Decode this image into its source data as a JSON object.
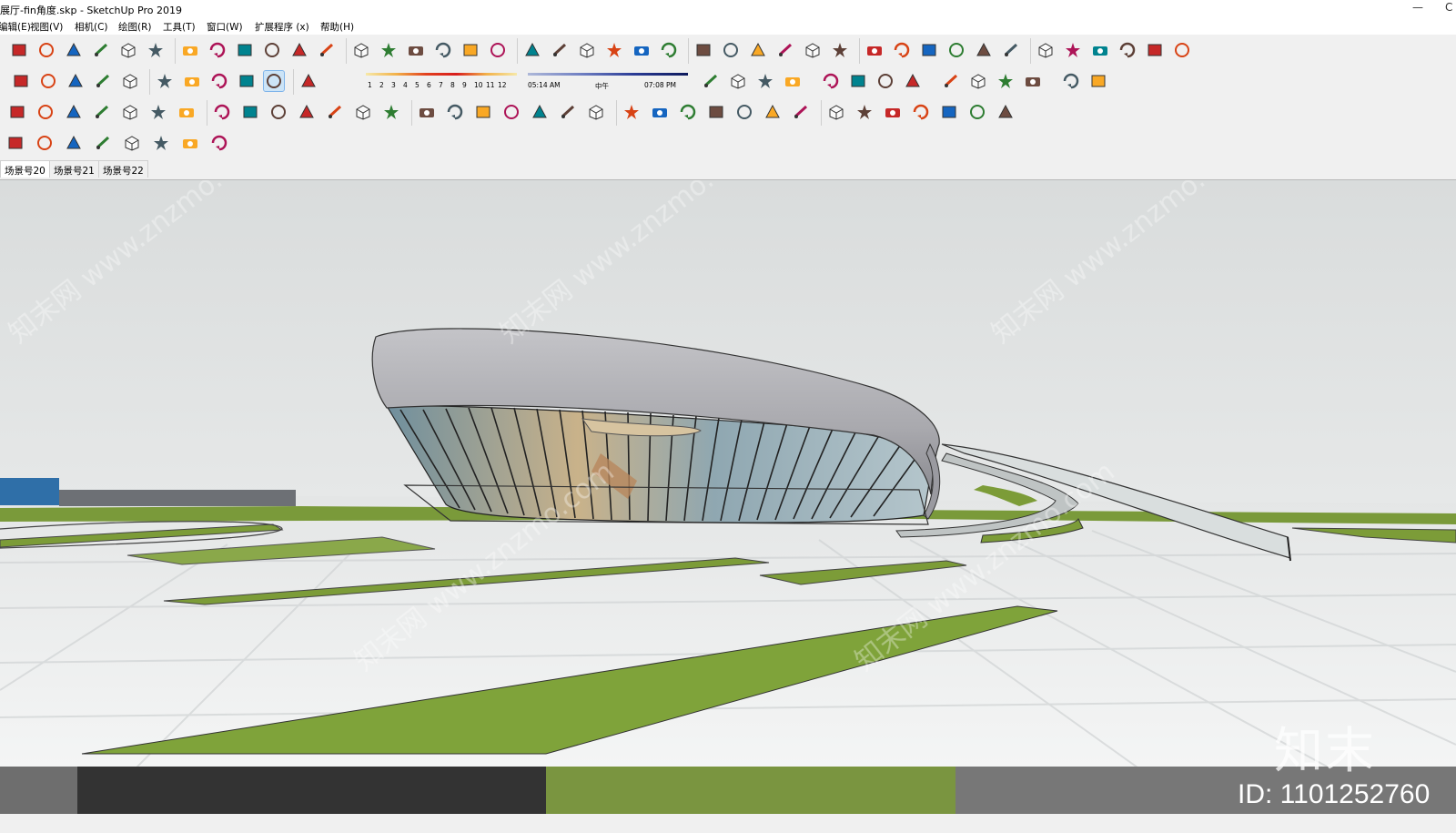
{
  "window": {
    "title": "展厅-fin角度.skp - SketchUp Pro 2019",
    "minimize_glyph": "—",
    "right_glyph": "C"
  },
  "menu": [
    {
      "label": "编辑(E)"
    },
    {
      "label": "视图(V)"
    },
    {
      "label": "相机(C)"
    },
    {
      "label": "绘图(R)"
    },
    {
      "label": "工具(T)"
    },
    {
      "label": "窗口(W)"
    },
    {
      "label": "扩展程序 (x)"
    },
    {
      "label": "帮助(H)"
    }
  ],
  "shadow_settings": {
    "months": [
      "1",
      "2",
      "3",
      "4",
      "5",
      "6",
      "7",
      "8",
      "9",
      "10",
      "11",
      "12"
    ],
    "sunrise_time": "05:14 AM",
    "noon_label": "中午",
    "sunset_time": "07:08 PM"
  },
  "scenes": [
    {
      "label": "场景号20",
      "selected": true
    },
    {
      "label": "场景号21",
      "selected": false
    },
    {
      "label": "场景号22",
      "selected": false
    }
  ],
  "watermark": {
    "id_text": "ID: 1101252760",
    "logo_text": "知末"
  },
  "icons": {
    "row1": [
      "pencil-icon",
      "arc-icon",
      "rectangle-icon",
      "push-pull-icon",
      "follow-me-icon",
      "move-icon",
      "rotate-icon",
      "scale-icon",
      "tape-measure-icon",
      "text-icon",
      "paint-bucket-icon",
      "orbit-icon",
      "pan-icon",
      "zoom-icon",
      "zoom-extents-icon",
      "outer-shell-icon",
      "intersect-icon",
      "subtract-icon",
      "ruby-icon",
      "user-icon",
      "section-icon",
      "cone-icon",
      "circle-icon",
      "protractor-icon",
      "axes-icon",
      "sun-icon",
      "dome-icon",
      "sphere-icon",
      "x-ray-icon",
      "components-icon",
      "iso-view-icon",
      "top-view-icon",
      "front-view-icon",
      "right-view-icon",
      "back-view-icon",
      "left-view-icon",
      "check-icon",
      "teapot-icon",
      "cloud-icon",
      "sync-icon",
      "layers-icon",
      "window-icon"
    ],
    "row2": [
      "select-icon",
      "eraser-icon",
      "face-icon",
      "style-icon",
      "material-icon",
      "house-icon",
      "building-icon",
      "home-icon",
      "roof-icon",
      "shadow-toggle-icon",
      "fog-icon",
      "layout-icon",
      "sandbox-icon",
      "grass-icon",
      "grid-icon",
      "su-app-icon",
      "ruby-cube-icon",
      "magnet-icon",
      "flip-icon",
      "lumion-icon",
      "play-icon",
      "stop-icon",
      "scene-export-icon",
      "camera-icon",
      "settings-gear-icon"
    ],
    "row3": [
      "profile-icon",
      "line-icon",
      "dimension-icon",
      "path-icon",
      "wall-icon",
      "door-icon",
      "window-tool-icon",
      "stair-icon",
      "cut-icon",
      "spline-icon",
      "frame-icon",
      "corner-icon",
      "gem-icon",
      "diamond-icon",
      "flower-icon",
      "palette-icon",
      "bulb-icon",
      "export-icon",
      "ph-icon",
      "document-icon",
      "document-export-icon",
      "expand-icon",
      "brick-icon",
      "mesh-icon",
      "terrain-icon",
      "terrain-edit-icon",
      "drape-icon",
      "hatch-icon",
      "film-icon",
      "reel-icon",
      "camera-rig-icon",
      "camera-track-icon",
      "send-icon",
      "send-all-icon",
      "delete-icon"
    ],
    "row4": [
      "transfer-icon",
      "add-icon",
      "tree-icon",
      "checker-icon",
      "cloud-upload-icon",
      "gear-cluster-icon",
      "mail-icon",
      "info-icon"
    ]
  }
}
